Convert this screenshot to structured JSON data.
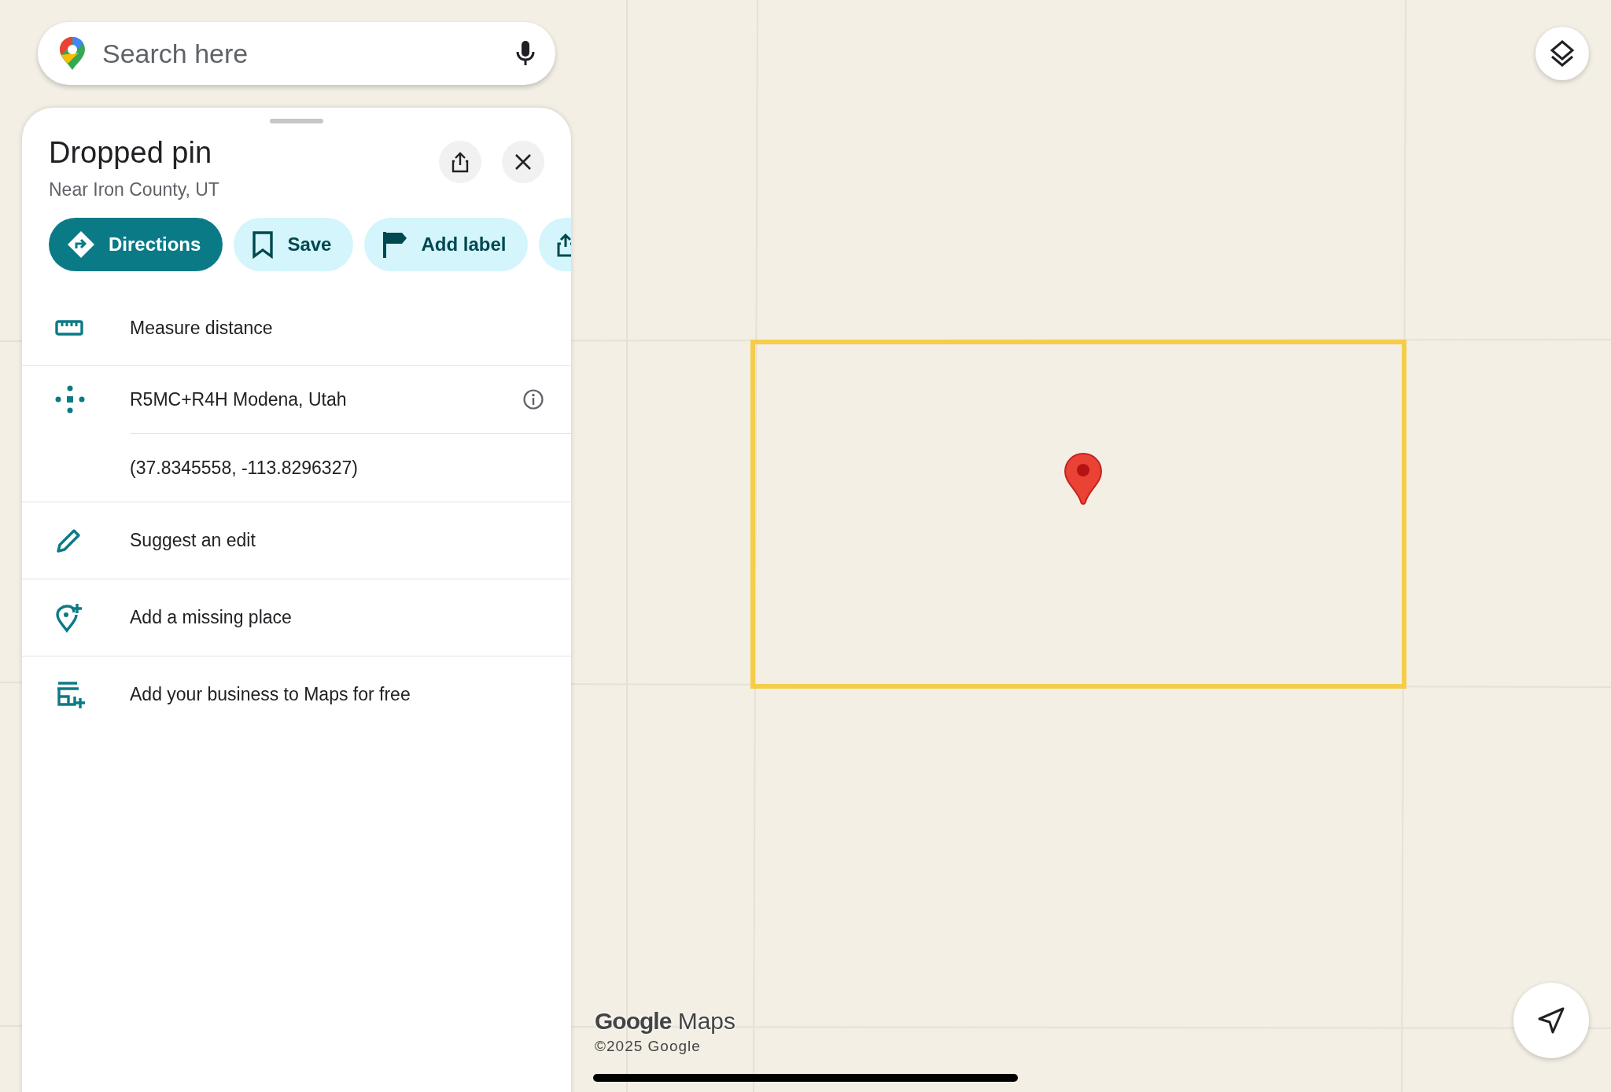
{
  "search": {
    "placeholder": "Search here"
  },
  "place": {
    "title": "Dropped pin",
    "subtitle": "Near Iron County, UT"
  },
  "actions": [
    {
      "kind": "directions",
      "label": "Directions",
      "primary": true
    },
    {
      "kind": "save",
      "label": "Save",
      "primary": false
    },
    {
      "kind": "label",
      "label": "Add label",
      "primary": false
    },
    {
      "kind": "share",
      "primary": false
    }
  ],
  "rows": [
    {
      "kind": "measure",
      "label": "Measure distance"
    },
    {
      "kind": "pluscode",
      "label": "R5MC+R4H Modena, Utah",
      "info": true,
      "sub": "(37.8345558, -113.8296327)"
    },
    {
      "kind": "edit",
      "label": "Suggest an edit"
    },
    {
      "kind": "addplace",
      "label": "Add a missing place"
    },
    {
      "kind": "business",
      "label": "Add your business to Maps for free"
    }
  ],
  "map": {
    "logo_brand": "Google",
    "logo_product": "Maps",
    "copyright": "©2025 Google"
  }
}
